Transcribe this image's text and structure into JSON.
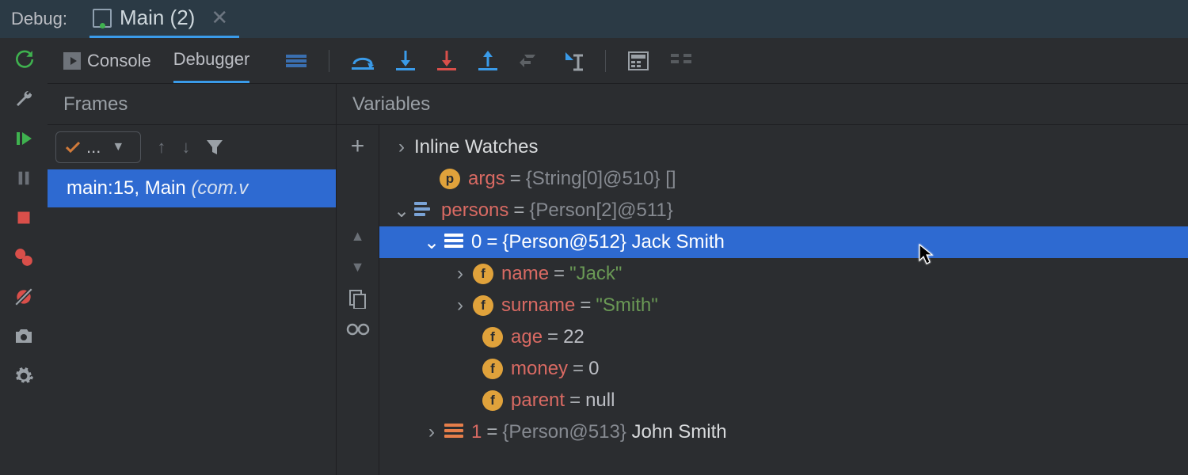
{
  "topbar": {
    "label": "Debug:",
    "tab": "Main (2)"
  },
  "toolbar": {
    "console": "Console",
    "debugger": "Debugger"
  },
  "frames": {
    "header": "Frames",
    "thread_dots": "...",
    "row_main": "main:15, Main ",
    "row_pkg": "(com.v"
  },
  "variables": {
    "header": "Variables",
    "inline_watches": "Inline Watches",
    "args": {
      "name": "args",
      "eq": "=",
      "value": "{String[0]@510} []"
    },
    "persons": {
      "name": "persons",
      "eq": "=",
      "value": "{Person[2]@511}"
    },
    "p0": {
      "idx": "0",
      "eq": "=",
      "type": "{Person@512}",
      "display": "Jack Smith"
    },
    "name_f": {
      "name": "name",
      "eq": "=",
      "value": "\"Jack\""
    },
    "surname_f": {
      "name": "surname",
      "eq": "=",
      "value": "\"Smith\""
    },
    "age_f": {
      "name": "age",
      "eq": "=",
      "value": "22"
    },
    "money_f": {
      "name": "money",
      "eq": "=",
      "value": "0"
    },
    "parent_f": {
      "name": "parent",
      "eq": "=",
      "value": "null"
    },
    "p1": {
      "idx": "1",
      "eq": "=",
      "type": "{Person@513}",
      "display": "John Smith"
    }
  }
}
